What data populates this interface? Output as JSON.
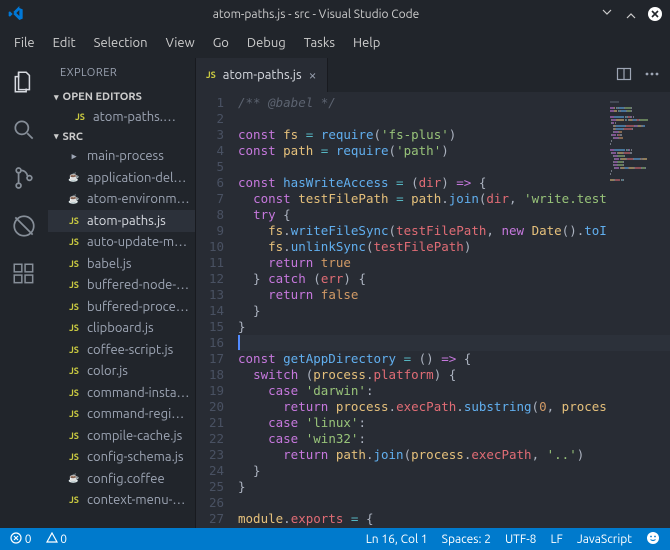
{
  "window": {
    "title": "atom-paths.js - src - Visual Studio Code"
  },
  "menu": [
    "File",
    "Edit",
    "Selection",
    "View",
    "Go",
    "Debug",
    "Tasks",
    "Help"
  ],
  "sidebar": {
    "title": "EXPLORER",
    "sections": {
      "open_editors": "OPEN EDITORS",
      "src": "SRC"
    },
    "open_item": {
      "icon": "JS",
      "label": "atom-paths.…"
    },
    "items": [
      {
        "icon": "folder",
        "label": "main-process",
        "type": "folder"
      },
      {
        "icon": "coffee",
        "label": "application-del…",
        "type": "coffee"
      },
      {
        "icon": "coffee",
        "label": "atom-environm…",
        "type": "coffee"
      },
      {
        "icon": "JS",
        "label": "atom-paths.js",
        "type": "js",
        "active": true
      },
      {
        "icon": "JS",
        "label": "auto-update-m…",
        "type": "js"
      },
      {
        "icon": "JS",
        "label": "babel.js",
        "type": "js"
      },
      {
        "icon": "JS",
        "label": "buffered-node-…",
        "type": "js"
      },
      {
        "icon": "JS",
        "label": "buffered-proce…",
        "type": "js"
      },
      {
        "icon": "JS",
        "label": "clipboard.js",
        "type": "js"
      },
      {
        "icon": "JS",
        "label": "coffee-script.js",
        "type": "js"
      },
      {
        "icon": "JS",
        "label": "color.js",
        "type": "js"
      },
      {
        "icon": "JS",
        "label": "command-insta…",
        "type": "js"
      },
      {
        "icon": "JS",
        "label": "command-regi…",
        "type": "js"
      },
      {
        "icon": "JS",
        "label": "compile-cache.js",
        "type": "js"
      },
      {
        "icon": "JS",
        "label": "config-schema.js",
        "type": "js"
      },
      {
        "icon": "coffee",
        "label": "config.coffee",
        "type": "coffee"
      },
      {
        "icon": "JS",
        "label": "context-menu-…",
        "type": "js"
      }
    ]
  },
  "tab": {
    "icon": "JS",
    "label": "atom-paths.js"
  },
  "code": {
    "lines": [
      [
        [
          "c-cm",
          "/** @babel */"
        ]
      ],
      [],
      [
        [
          "c-kw",
          "const "
        ],
        [
          "c-vr",
          "fs"
        ],
        [
          "c-pn",
          " "
        ],
        [
          "c-op",
          "="
        ],
        [
          "c-pn",
          " "
        ],
        [
          "c-fn",
          "require"
        ],
        [
          "c-pn",
          "("
        ],
        [
          "c-st",
          "'fs-plus'"
        ],
        [
          "c-pn",
          ")"
        ]
      ],
      [
        [
          "c-kw",
          "const "
        ],
        [
          "c-vr",
          "path"
        ],
        [
          "c-pn",
          " "
        ],
        [
          "c-op",
          "="
        ],
        [
          "c-pn",
          " "
        ],
        [
          "c-fn",
          "require"
        ],
        [
          "c-pn",
          "("
        ],
        [
          "c-st",
          "'path'"
        ],
        [
          "c-pn",
          ")"
        ]
      ],
      [],
      [
        [
          "c-kw",
          "const "
        ],
        [
          "c-fn",
          "hasWriteAccess"
        ],
        [
          "c-pn",
          " "
        ],
        [
          "c-op",
          "="
        ],
        [
          "c-pn",
          " ("
        ],
        [
          "c-pr",
          "dir"
        ],
        [
          "c-pn",
          ") "
        ],
        [
          "c-kw",
          "=>"
        ],
        [
          "c-pn",
          " {"
        ]
      ],
      [
        [
          "c-pn",
          "  "
        ],
        [
          "c-kw",
          "const "
        ],
        [
          "c-vr",
          "testFilePath"
        ],
        [
          "c-pn",
          " "
        ],
        [
          "c-op",
          "="
        ],
        [
          "c-pn",
          " "
        ],
        [
          "c-vr",
          "path"
        ],
        [
          "c-pn",
          "."
        ],
        [
          "c-fn",
          "join"
        ],
        [
          "c-pn",
          "("
        ],
        [
          "c-pr",
          "dir"
        ],
        [
          "c-pn",
          ", "
        ],
        [
          "c-st",
          "'write.test"
        ]
      ],
      [
        [
          "c-pn",
          "  "
        ],
        [
          "c-kw",
          "try"
        ],
        [
          "c-pn",
          " {"
        ]
      ],
      [
        [
          "c-pn",
          "    "
        ],
        [
          "c-vr",
          "fs"
        ],
        [
          "c-pn",
          "."
        ],
        [
          "c-fn",
          "writeFileSync"
        ],
        [
          "c-pn",
          "("
        ],
        [
          "c-pr",
          "testFilePath"
        ],
        [
          "c-pn",
          ", "
        ],
        [
          "c-kw",
          "new"
        ],
        [
          "c-pn",
          " "
        ],
        [
          "c-vr",
          "Date"
        ],
        [
          "c-pn",
          "()."
        ],
        [
          "c-fn",
          "toI"
        ]
      ],
      [
        [
          "c-pn",
          "    "
        ],
        [
          "c-vr",
          "fs"
        ],
        [
          "c-pn",
          "."
        ],
        [
          "c-fn",
          "unlinkSync"
        ],
        [
          "c-pn",
          "("
        ],
        [
          "c-pr",
          "testFilePath"
        ],
        [
          "c-pn",
          ")"
        ]
      ],
      [
        [
          "c-pn",
          "    "
        ],
        [
          "c-kw",
          "return"
        ],
        [
          "c-pn",
          " "
        ],
        [
          "c-nm",
          "true"
        ]
      ],
      [
        [
          "c-pn",
          "  } "
        ],
        [
          "c-kw",
          "catch"
        ],
        [
          "c-pn",
          " ("
        ],
        [
          "c-pr",
          "err"
        ],
        [
          "c-pn",
          ") {"
        ]
      ],
      [
        [
          "c-pn",
          "    "
        ],
        [
          "c-kw",
          "return"
        ],
        [
          "c-pn",
          " "
        ],
        [
          "c-nm",
          "false"
        ]
      ],
      [
        [
          "c-pn",
          "  }"
        ]
      ],
      [
        [
          "c-pn",
          "}"
        ]
      ],
      [],
      [
        [
          "c-kw",
          "const "
        ],
        [
          "c-fn",
          "getAppDirectory"
        ],
        [
          "c-pn",
          " "
        ],
        [
          "c-op",
          "="
        ],
        [
          "c-pn",
          " () "
        ],
        [
          "c-kw",
          "=>"
        ],
        [
          "c-pn",
          " {"
        ]
      ],
      [
        [
          "c-pn",
          "  "
        ],
        [
          "c-kw",
          "switch"
        ],
        [
          "c-pn",
          " ("
        ],
        [
          "c-vr",
          "process"
        ],
        [
          "c-pn",
          "."
        ],
        [
          "c-pr",
          "platform"
        ],
        [
          "c-pn",
          ") {"
        ]
      ],
      [
        [
          "c-pn",
          "    "
        ],
        [
          "c-kw",
          "case"
        ],
        [
          "c-pn",
          " "
        ],
        [
          "c-st",
          "'darwin'"
        ],
        [
          "c-pn",
          ":"
        ]
      ],
      [
        [
          "c-pn",
          "      "
        ],
        [
          "c-kw",
          "return"
        ],
        [
          "c-pn",
          " "
        ],
        [
          "c-vr",
          "process"
        ],
        [
          "c-pn",
          "."
        ],
        [
          "c-pr",
          "execPath"
        ],
        [
          "c-pn",
          "."
        ],
        [
          "c-fn",
          "substring"
        ],
        [
          "c-pn",
          "("
        ],
        [
          "c-nm",
          "0"
        ],
        [
          "c-pn",
          ", "
        ],
        [
          "c-vr",
          "proces"
        ]
      ],
      [
        [
          "c-pn",
          "    "
        ],
        [
          "c-kw",
          "case"
        ],
        [
          "c-pn",
          " "
        ],
        [
          "c-st",
          "'linux'"
        ],
        [
          "c-pn",
          ":"
        ]
      ],
      [
        [
          "c-pn",
          "    "
        ],
        [
          "c-kw",
          "case"
        ],
        [
          "c-pn",
          " "
        ],
        [
          "c-st",
          "'win32'"
        ],
        [
          "c-pn",
          ":"
        ]
      ],
      [
        [
          "c-pn",
          "      "
        ],
        [
          "c-kw",
          "return"
        ],
        [
          "c-pn",
          " "
        ],
        [
          "c-vr",
          "path"
        ],
        [
          "c-pn",
          "."
        ],
        [
          "c-fn",
          "join"
        ],
        [
          "c-pn",
          "("
        ],
        [
          "c-vr",
          "process"
        ],
        [
          "c-pn",
          "."
        ],
        [
          "c-pr",
          "execPath"
        ],
        [
          "c-pn",
          ", "
        ],
        [
          "c-st",
          "'..'"
        ],
        [
          "c-pn",
          ")"
        ]
      ],
      [
        [
          "c-pn",
          "  }"
        ]
      ],
      [
        [
          "c-pn",
          "}"
        ]
      ],
      [],
      [
        [
          "c-vr",
          "module"
        ],
        [
          "c-pn",
          "."
        ],
        [
          "c-pr",
          "exports"
        ],
        [
          "c-pn",
          " "
        ],
        [
          "c-op",
          "="
        ],
        [
          "c-pn",
          " {"
        ]
      ]
    ],
    "highlight_line": 16
  },
  "status": {
    "errors": "0",
    "warnings": "0",
    "ln_col": "Ln 16, Col 1",
    "spaces": "Spaces: 2",
    "encoding": "UTF-8",
    "eol": "LF",
    "lang": "JavaScript"
  }
}
